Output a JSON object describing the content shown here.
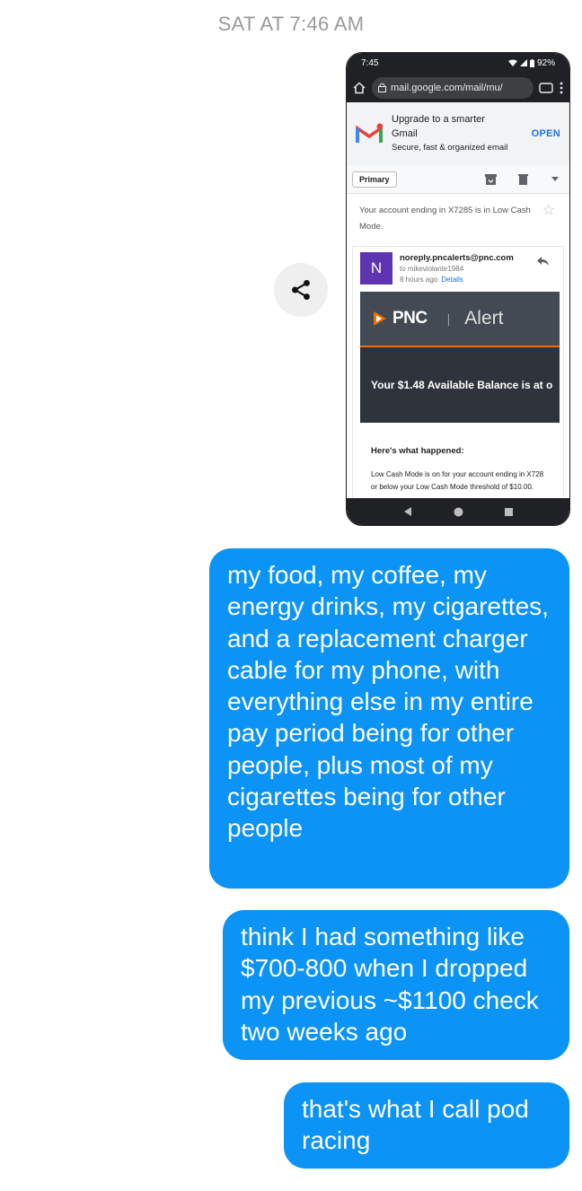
{
  "timestamp": "SAT AT 7:46 AM",
  "phone": {
    "status_time": "7:45",
    "battery": "92%",
    "url": "mail.google.com/mail/mu/",
    "banner": {
      "title_line1": "Upgrade to a smarter",
      "title_line2": "Gmail",
      "subtitle": "Secure, fast & organized email",
      "open_label": "OPEN"
    },
    "toolbar": {
      "label_chip": "Primary"
    },
    "subject": "Your account ending in X7285 is in Low Cash Mode.",
    "sender": {
      "avatar_letter": "N",
      "from": "noreply.pncalerts@pnc.com",
      "to": "to mikeviolante1984",
      "time": "8 hours ago",
      "details": "Details"
    },
    "pnc": {
      "logo_text": "PNC",
      "separator": "|",
      "header_label": "Alert",
      "balance_line": "Your $1.48 Available Balance is at o",
      "heading": "Here's what happened:",
      "line1": "Low Cash Mode is on for your account ending in X728",
      "line2": "or below your Low Cash Mode threshold of $10.00."
    }
  },
  "messages": [
    {
      "text": "my food, my coffee, my energy drinks, my cigarettes, and a replacement charger cable for my phone, with everything else in my entire pay period being for other people, plus most of my cigarettes being for other people"
    },
    {
      "text": "think I had something like $700-800 when I dropped my previous ~$1100 check two weeks ago"
    },
    {
      "text": "that's what I call pod racing"
    }
  ],
  "colors": {
    "bubble": "#0b93f6",
    "gmail_avatar": "#5e35b1",
    "pnc_orange": "#ef6c00",
    "link": "#1a73e8"
  }
}
